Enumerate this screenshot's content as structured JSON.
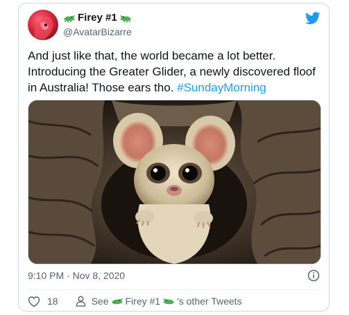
{
  "tweet": {
    "display_name": "Firey #1",
    "handle": "@AvatarBizarre",
    "text_main": "And just like that, the world became a lot better. Introducing the Greater Glider, a newly discovered floof in Australia! Those ears tho. ",
    "hashtag": "#SundayMorning",
    "timestamp": "9:10 PM · Nov 8, 2020",
    "likes": "18",
    "see_prefix": "See",
    "see_name": "Firey #1",
    "see_suffix": "'s other Tweets"
  },
  "icons": {
    "logo": "twitter-bird-icon",
    "name_emoji": "crocodile-emoji-icon",
    "info": "info-icon",
    "like": "heart-icon",
    "profile": "person-icon"
  },
  "colors": {
    "accent": "#1d9bf0",
    "text": "#0f1419",
    "muted": "#536471",
    "border": "#cfd9de",
    "croc": "#4caf50"
  }
}
